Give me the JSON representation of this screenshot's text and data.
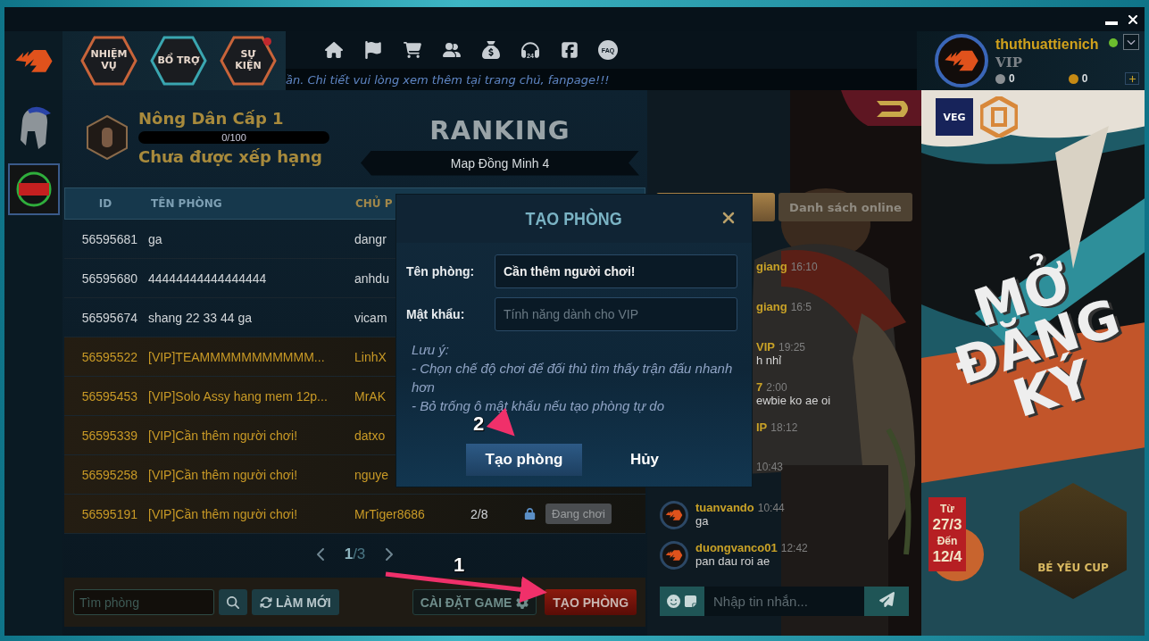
{
  "top_bar": {
    "hex_buttons": [
      {
        "label": "NHIỆM\nVỤ",
        "color": "#c8643a",
        "notice": false
      },
      {
        "label": "BỔ TRỢ",
        "color": "#3aa6b0",
        "notice": false
      },
      {
        "label": "SỰ\nKIỆN",
        "color": "#c8643a",
        "notice": true
      }
    ],
    "icons": [
      {
        "kind": "home"
      },
      {
        "kind": "flag"
      },
      {
        "kind": "cart"
      },
      {
        "kind": "friends"
      },
      {
        "kind": "money"
      },
      {
        "kind": "support",
        "label": "24"
      },
      {
        "kind": "facebook"
      },
      {
        "kind": "faq",
        "label": "FAQ"
      }
    ],
    "marquee": "ần. Chi tiết vui lòng xem thêm tại trang chủ, fanpage!!!"
  },
  "profile": {
    "username": "thuthuattienich",
    "rank": "VIP",
    "silver": "0",
    "gold": "0",
    "online": true
  },
  "level": {
    "title": "Nông Dân Cấp 1",
    "progress": "0/100",
    "level": 0,
    "rank_status": "Chưa được xếp hạng"
  },
  "ranking": {
    "title": "RANKING",
    "map": "Map Đồng Minh 4"
  },
  "room_table": {
    "columns": [
      "ID",
      "TÊN PHÒNG",
      "CHỦ P"
    ],
    "rows": [
      {
        "id": "56595681",
        "name": "ga",
        "owner": "dangr",
        "vip": false
      },
      {
        "id": "56595680",
        "name": "44444444444444444",
        "owner": "anhdu",
        "vip": false
      },
      {
        "id": "56595674",
        "name": "shang 22 33 44 ga",
        "owner": "vicam",
        "vip": false
      },
      {
        "id": "56595522",
        "name": "[VIP]TEAMMMMMMMMMMM...",
        "owner": "LinhX",
        "vip": true
      },
      {
        "id": "56595453",
        "name": "[VIP]Solo Assy hang mem 12p...",
        "owner": "MrAK",
        "vip": true
      },
      {
        "id": "56595339",
        "name": "[VIP]Cần thêm người chơi!",
        "owner": "datxo",
        "vip": true
      },
      {
        "id": "56595258",
        "name": "[VIP]Cần thêm người chơi!",
        "owner": "nguye",
        "vip": true
      },
      {
        "id": "56595191",
        "name": "[VIP]Cần thêm người chơi!",
        "owner": "MrTiger8686",
        "players": "2/8",
        "locked": true,
        "status": "Đang chơi",
        "vip": true
      }
    ]
  },
  "pagination": {
    "page": "**1**/3"
  },
  "toolbar": {
    "search_placeholder": "Tìm phòng",
    "refresh": "LÀM MỚI",
    "settings": "CÀI ĐẶT GAME",
    "create": "TẠO PHÒNG"
  },
  "chat": {
    "tabs": [
      {
        "selected": true
      },
      {
        "label": "Danh sách online",
        "selected": false
      }
    ],
    "messages": [
      {
        "name": "giang",
        "time": "16:10",
        "partial": true
      },
      {
        "name": "giang",
        "time": "16:5",
        "partial": true
      },
      {
        "name": "VIP",
        "time": "19:25",
        "text": "h nhỉ",
        "partial": true
      },
      {
        "name": "7",
        "time": "2:00",
        "text": "ewbie ko ae oi",
        "partial": true
      },
      {
        "name": "IP",
        "time": "18:12",
        "partial": true
      },
      {
        "time": "10:43",
        "partial": true
      },
      {
        "name": "tuanvando",
        "time": "10:44",
        "text": "ga",
        "partial": false
      },
      {
        "name": "duongvanco01",
        "time": "12:42",
        "text": "pan dau roi ae",
        "partial": false
      }
    ],
    "input_placeholder": "Nhập tin nhắn..."
  },
  "banner": {
    "sponsor": "VEG",
    "headline": [
      "MỞ",
      "ĐĂNG",
      "KÝ"
    ],
    "from_label": "Từ",
    "from": "27/3",
    "to_label": "Đến",
    "to": "12/4",
    "cup": "BÉ YÊU CUP"
  },
  "dialog": {
    "title": "TẠO PHÒNG",
    "fields": [
      {
        "label": "Tên phòng:",
        "value": "Cần thêm người chơi!"
      },
      {
        "label": "Mật khẩu:",
        "placeholder": "Tính năng dành cho VIP"
      }
    ],
    "note_title": "Lưu ý:",
    "notes": [
      "- Chọn chế độ chơi để đối thủ tìm thấy trận đấu nhanh hơn",
      "- Bỏ trống ô mật khẩu nếu tạo phòng tự do"
    ],
    "buttons": [
      {
        "label": "Tạo phòng",
        "kind": "primary"
      },
      {
        "label": "Hủy",
        "kind": "plain"
      }
    ]
  },
  "annotations": [
    {
      "label": "1"
    },
    {
      "label": "2"
    }
  ]
}
